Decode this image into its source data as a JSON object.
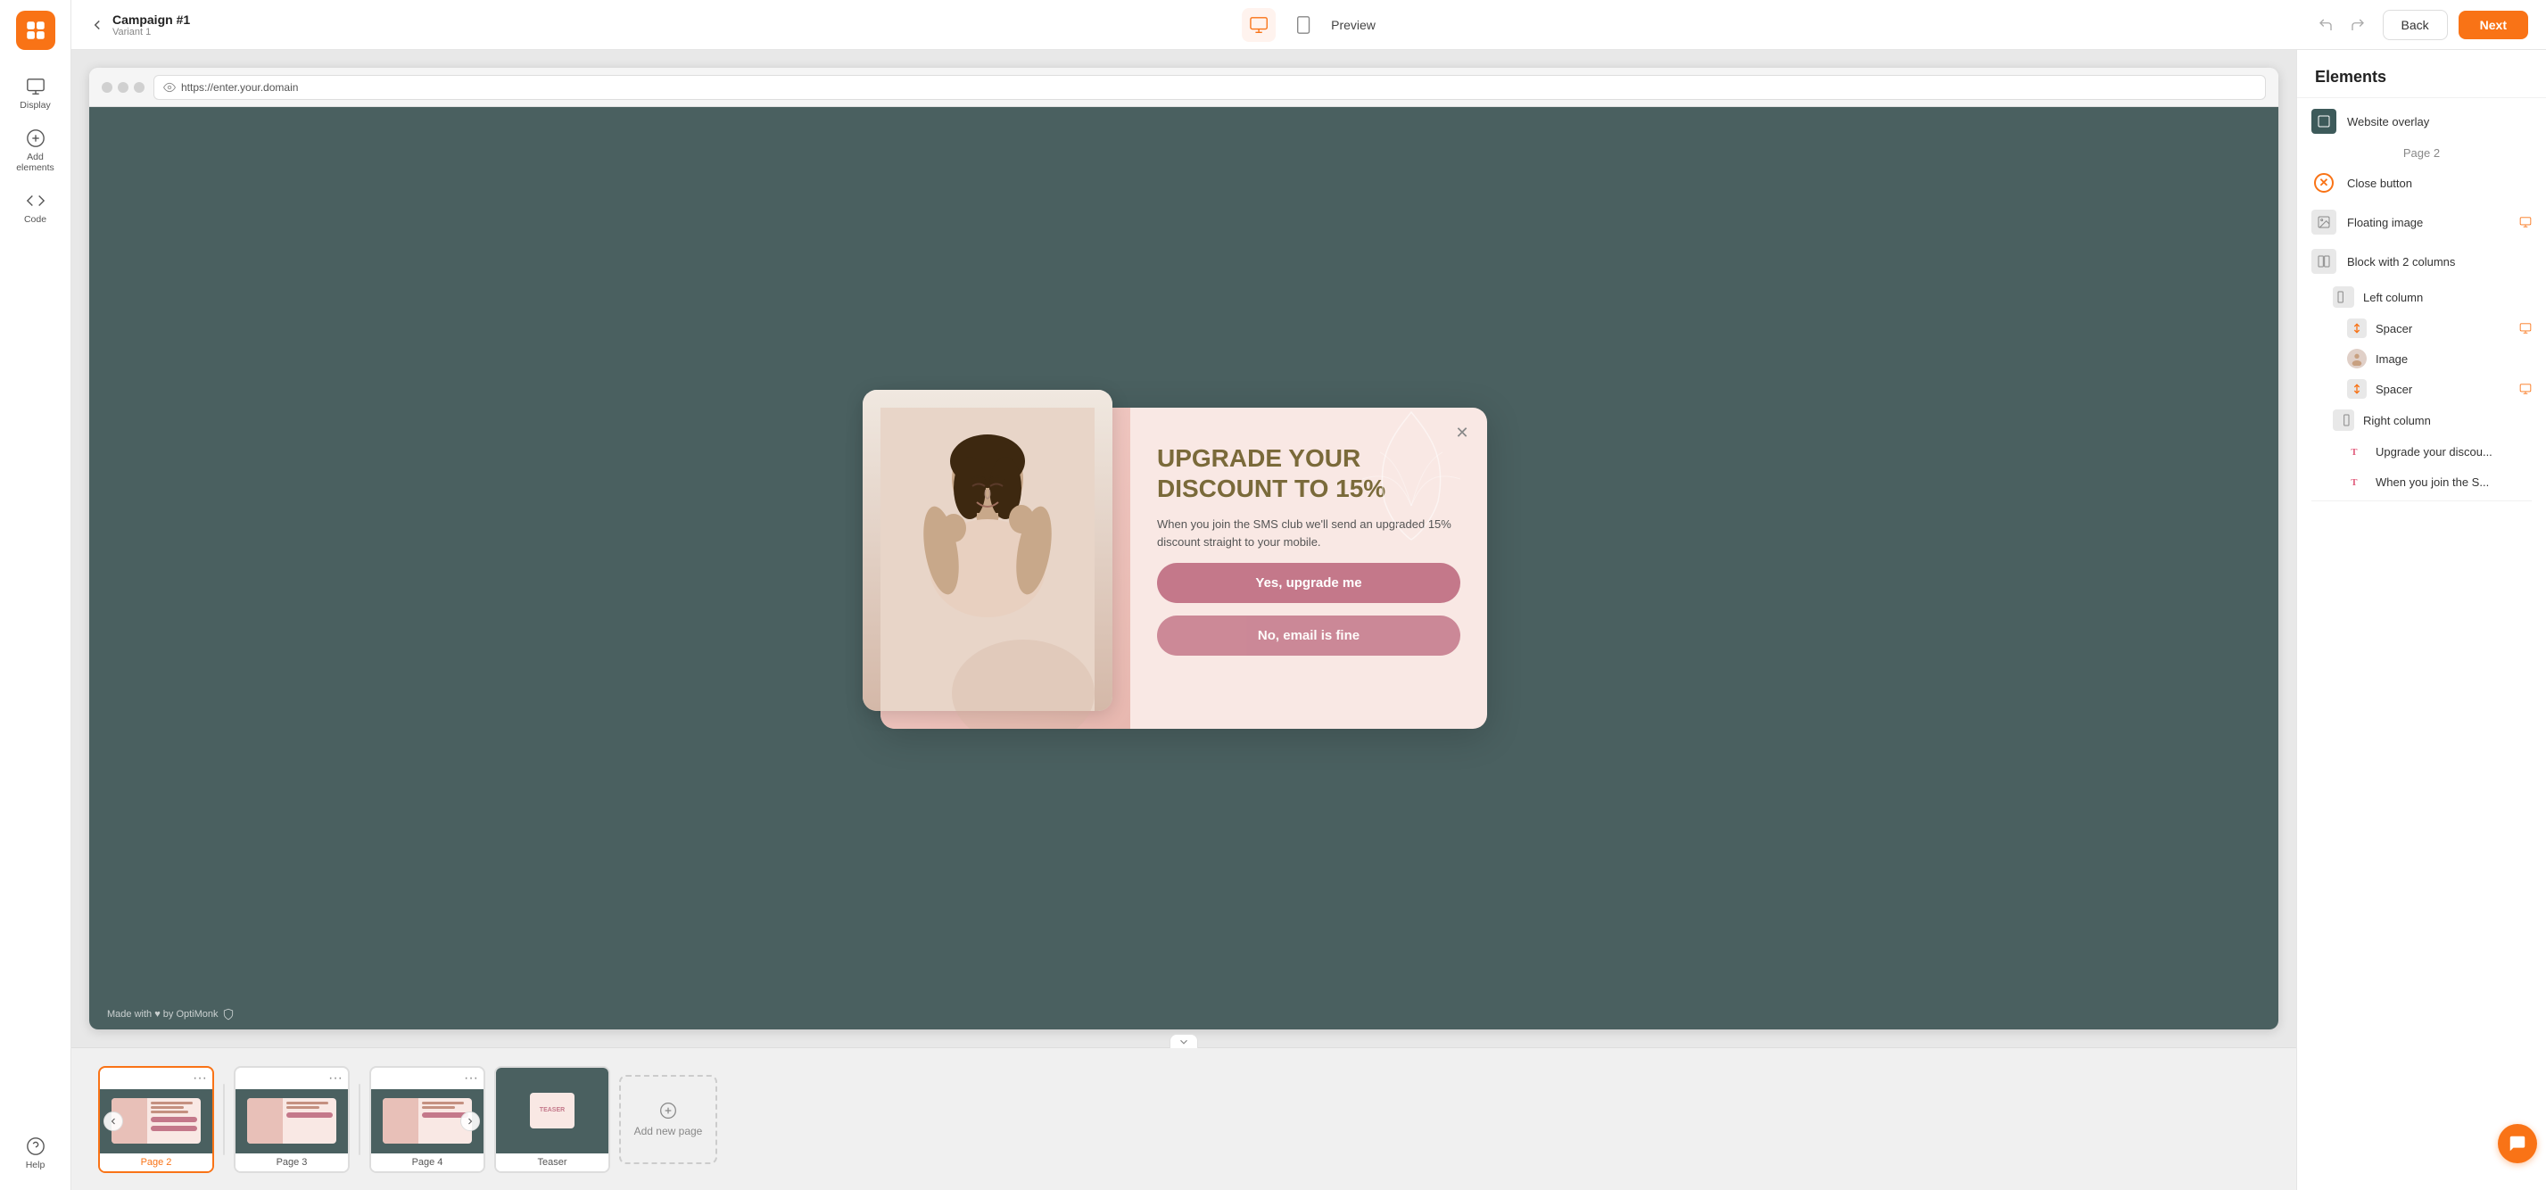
{
  "topbar": {
    "campaign_name": "Campaign #1",
    "variant_name": "Variant 1",
    "preview_label": "Preview",
    "back_label": "Back",
    "next_label": "Next"
  },
  "browser": {
    "url": "https://enter.your.domain"
  },
  "popup": {
    "headline": "UPGRADE YOUR DISCOUNT TO 15%",
    "body_text": "When you join the SMS club we'll send an upgraded 15% discount straight to your mobile.",
    "btn_primary": "Yes, upgrade me",
    "btn_secondary": "No, email is fine",
    "footer_text": "Made with ♥ by OptiMonk"
  },
  "pages": {
    "page2_label": "Page 2",
    "page3_label": "Page 3",
    "page4_label": "Page 4",
    "teaser_label": "Teaser",
    "add_page_label": "Add new page"
  },
  "panel": {
    "title": "Elements",
    "items": [
      {
        "label": "Website overlay",
        "type": "dark",
        "indent": 0
      },
      {
        "label": "Page 2",
        "type": "section",
        "indent": 0
      },
      {
        "label": "Close button",
        "type": "close",
        "indent": 0
      },
      {
        "label": "Floating image",
        "type": "gray",
        "indent": 0,
        "device": true
      },
      {
        "label": "Block with 2 columns",
        "type": "gray",
        "indent": 0
      },
      {
        "label": "Left column",
        "type": "gray",
        "indent": 1
      },
      {
        "label": "Spacer",
        "type": "gray",
        "indent": 2,
        "device": true
      },
      {
        "label": "Image",
        "type": "image",
        "indent": 2
      },
      {
        "label": "Spacer",
        "type": "gray",
        "indent": 2,
        "device": true
      },
      {
        "label": "Right column",
        "type": "gray",
        "indent": 1
      },
      {
        "label": "Upgrade your discou...",
        "type": "text",
        "indent": 2
      },
      {
        "label": "When you join the S...",
        "type": "text",
        "indent": 2
      }
    ]
  }
}
